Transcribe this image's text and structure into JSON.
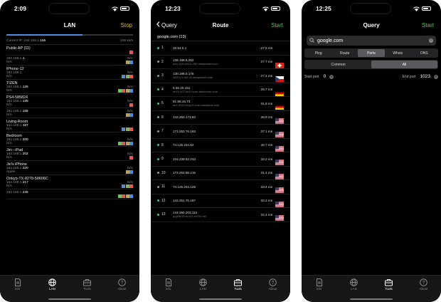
{
  "lan": {
    "time": "2:09",
    "title": "LAN",
    "stop_label": "Stop",
    "progress_fraction": 0.6,
    "current_ip_label": "Current IP: 192.168.1.",
    "current_ip_bold": "155",
    "speed": "100 ks/s",
    "devices": [
      {
        "name": "Public AP (11)",
        "ip": "",
        "ipb": "",
        "sub": "",
        "right": ""
      },
      {
        "name": "",
        "ip": "192.168.1.",
        "ipb": "1",
        "sub": "N/A",
        "right": "N/A"
      },
      {
        "name": "iPhone-12",
        "ip": "192.168.1.",
        "ipb": "",
        "sub": "N/A",
        "right": "N/A"
      },
      {
        "name": "TIZEN",
        "ip": "192.168.1.",
        "ipb": "125",
        "sub": "N/A",
        "right": "N/A"
      },
      {
        "name": "PS4-585824",
        "ip": "192.168.1.",
        "ipb": "138",
        "sub": "N/A",
        "right": "N/A"
      },
      {
        "name": "",
        "ip": "192.168.1.",
        "ipb": "165",
        "sub": "N/A",
        "right": "N/A"
      },
      {
        "name": "Living-Room",
        "ip": "192.168.1.",
        "ipb": "167",
        "sub": "N/A",
        "right": ""
      },
      {
        "name": "Bedroom",
        "ip": "192.168.1.",
        "ipb": "200",
        "sub": "N/A",
        "right": "N/A"
      },
      {
        "name": "Jiri---iPad",
        "ip": "192.168.1.",
        "ipb": "202",
        "sub": "N/A",
        "right": "N/A"
      },
      {
        "name": "Jiri's iPhone",
        "ip": "192.168.1.",
        "ipb": "220",
        "sub": "Apple",
        "right": "N/A"
      },
      {
        "name": "Onkyo-TX-8270-50606C",
        "ip": "192.168.1.",
        "ipb": "217",
        "sub": "N/A",
        "right": "N/A"
      },
      {
        "name": "",
        "ip": "192.168.1.",
        "ipb": "245",
        "sub": "",
        "right": ""
      }
    ]
  },
  "route": {
    "time": "12:23",
    "back_label": "Query",
    "title": "Route",
    "start_label": "Start",
    "target": "google.com (13)",
    "hops": [
      {
        "no": "1",
        "ip": "10.64.0.1",
        "host": "",
        "ms": "27.5 ms",
        "flag": ""
      },
      {
        "no": "2",
        "ip": "138.199.6.252",
        "host": "unn-138-199-6-252.datapacket.com",
        "ms": "27.7 ms",
        "flag": "ch"
      },
      {
        "no": "3",
        "ip": "138.199.0.178",
        "host": "vl203.r1.dc1.cz.datapacket.com",
        "ms": "27.2 ms",
        "flag": "cz"
      },
      {
        "no": "4",
        "ip": "5.56.20.161",
        "host": "ae10-407.ce10.core-backbone.com",
        "ms": "28.7 ms",
        "flag": "de"
      },
      {
        "no": "5",
        "ip": "81.95.15.73",
        "host": "ae7-2023.nbg10.core-backbone.com",
        "ms": "31.9 ms",
        "flag": "de"
      },
      {
        "no": "6",
        "ip": "142.250.173.84",
        "host": "",
        "ms": "39.9 ms",
        "flag": "us"
      },
      {
        "no": "7",
        "ip": "172.253.76.193",
        "host": "",
        "ms": "37.1 ms",
        "flag": "us"
      },
      {
        "no": "8",
        "ip": "74.125.244.82",
        "host": "",
        "ms": "40.7 ms",
        "flag": "us"
      },
      {
        "no": "9",
        "ip": "216.239.62.243",
        "host": "",
        "ms": "32.2 ms",
        "flag": "us"
      },
      {
        "no": "10",
        "ip": "172.253.66.215",
        "host": "",
        "ms": "31.4 ms",
        "flag": "us"
      },
      {
        "no": "11",
        "ip": "74.125.243.129",
        "host": "",
        "ms": "33.4 ms",
        "flag": "us"
      },
      {
        "no": "12",
        "ip": "142.251.76.187",
        "host": "",
        "ms": "32.2 ms",
        "flag": "us"
      },
      {
        "no": "13",
        "ip": "142.250.203.110",
        "host": "prg03s10-in-f14.1e100.net",
        "ms": "32.4 ms",
        "flag": "us"
      }
    ]
  },
  "query": {
    "time": "12:25",
    "title": "Query",
    "start_label": "Start",
    "search_value": "google.com",
    "tabs": [
      "Ping",
      "Route",
      "Ports",
      "Whois",
      "DNS"
    ],
    "selected_tab": "Ports",
    "modes": [
      "Common",
      "All"
    ],
    "selected_mode": "All",
    "start_port_label": "Start port",
    "start_port_value": "0",
    "end_port_label": "End port",
    "end_port_value": "1023"
  },
  "tabbar": [
    {
      "label": "Info",
      "icon": "doc-icon"
    },
    {
      "label": "LAN",
      "icon": "globe-icon"
    },
    {
      "label": "Tools",
      "icon": "toolbox-icon"
    },
    {
      "label": "About",
      "icon": "question-icon"
    }
  ],
  "colors": {
    "accent_stop": "#d7b53a",
    "accent_start": "#5ec15e",
    "hop_dot": "#44c16a"
  }
}
